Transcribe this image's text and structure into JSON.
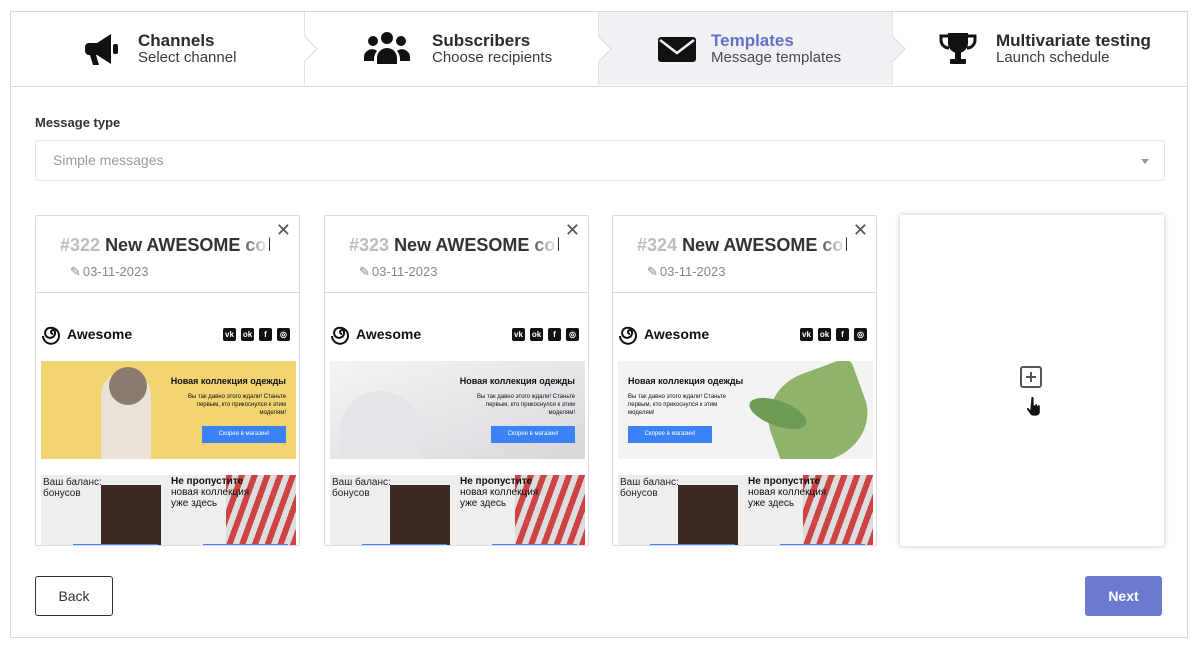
{
  "steps": [
    {
      "title": "Channels",
      "subtitle": "Select channel",
      "icon": "megaphone-icon"
    },
    {
      "title": "Subscribers",
      "subtitle": "Choose recipients",
      "icon": "users-icon"
    },
    {
      "title": "Templates",
      "subtitle": "Message templates",
      "icon": "envelope-icon",
      "active": true
    },
    {
      "title": "Multivariate testing",
      "subtitle": "Launch schedule",
      "icon": "trophy-icon"
    }
  ],
  "message_type": {
    "label": "Message type",
    "value": "Simple messages"
  },
  "templates": [
    {
      "number": "#322",
      "title": "New AWESOME coll",
      "date": "03-11-2023"
    },
    {
      "number": "#323",
      "title": "New AWESOME coll",
      "date": "03-11-2023"
    },
    {
      "number": "#324",
      "title": "New AWESOME coll",
      "date": "03-11-2023"
    }
  ],
  "preview": {
    "logo": "Awesome",
    "banner_title": "Новая коллекция одежды",
    "banner_text": "Вы так давно этого ждали! Станьте первым, кто прикоснулся к этим моделям!",
    "banner_button": "Скорее в магазин!",
    "balance_text": "Ваш баланс: бонусов",
    "promo_bold": "Не пропустите",
    "promo_text": "новая коллекция уже здесь"
  },
  "buttons": {
    "back": "Back",
    "next": "Next"
  },
  "colors": {
    "accent": "#6b79cf",
    "active_step_bg": "#f0f1f4",
    "cta_blue": "#3b82f6"
  }
}
